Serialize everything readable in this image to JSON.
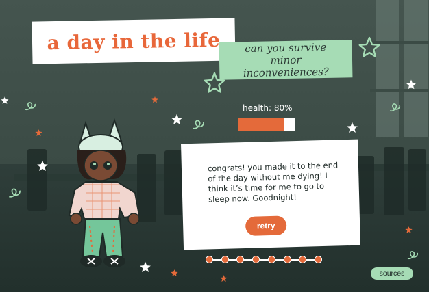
{
  "title": "a day in the life",
  "subtitle": "can you survive minor inconveniences?",
  "health": {
    "label": "health: 80%",
    "value": 0.8
  },
  "dialog": {
    "text": "congrats! you made it to the end of the day without me dying! I think it’s time for me to go to sleep now. Goodnight!"
  },
  "retry_label": "retry",
  "sources_label": "sources",
  "progress": {
    "steps": 8,
    "completed": 8
  },
  "colors": {
    "accent": "#e46a3a",
    "mint": "#a6dcb5",
    "bg": "#3a4a44"
  },
  "icons": [
    "star-icon",
    "swirl-icon",
    "character-sprite"
  ]
}
